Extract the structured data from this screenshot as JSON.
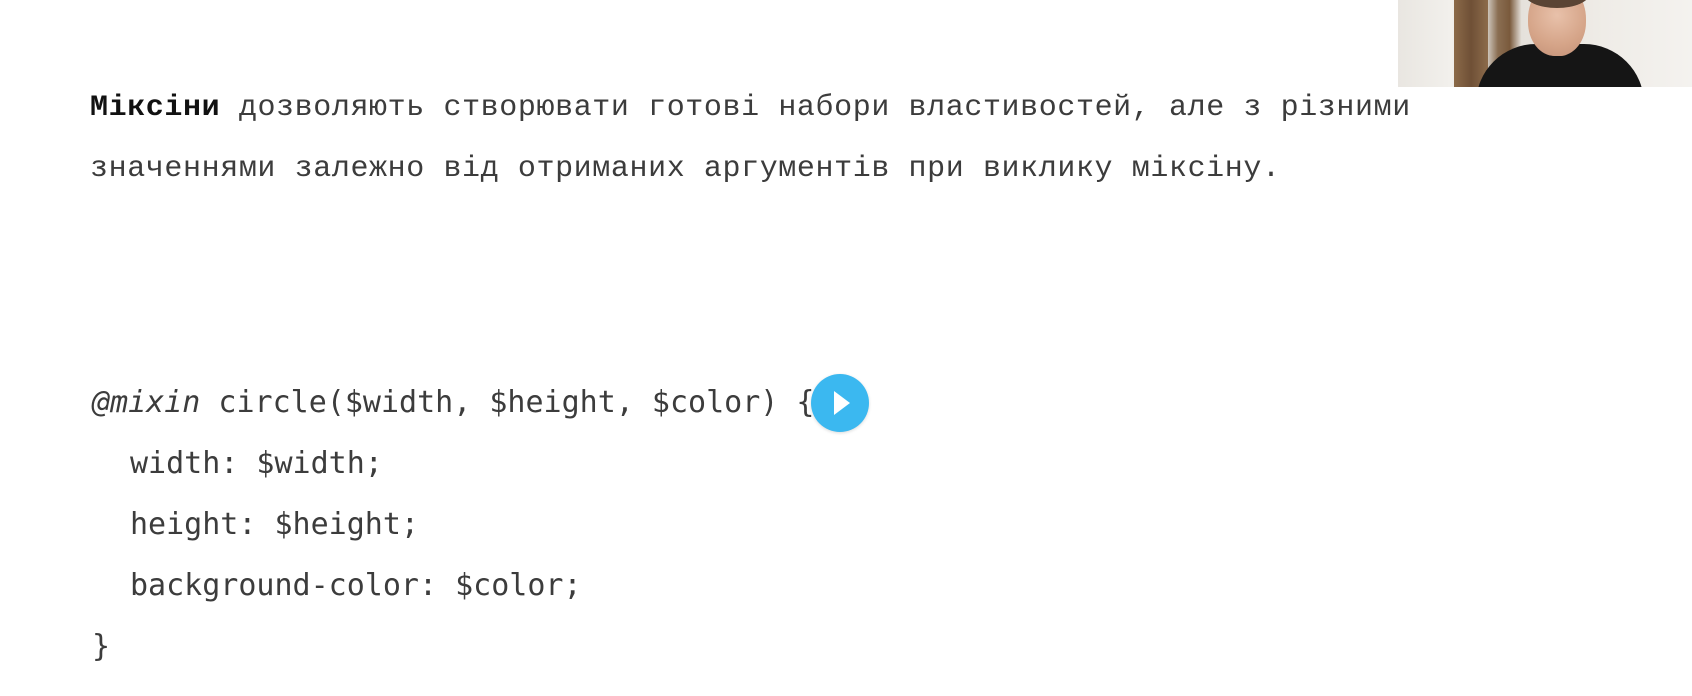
{
  "intro": {
    "keyword": "Міксіни",
    "text_line1": " дозволяють створювати готові набори властивостей, але з різними",
    "text_line2": "значеннями залежно від отриманих аргументів при виклику міксіну."
  },
  "code": {
    "line1_at": "@mixin",
    "line1_rest": " circle($width, $height, $color) {",
    "line2": "width: $width;",
    "line3": "height: $height;",
    "line4": "background-color: $color;",
    "line5": "}"
  },
  "player": {
    "play_icon": "play-icon",
    "accent_color": "#3bb8f0"
  },
  "webcam": {
    "description_icon": "presenter-webcam"
  }
}
